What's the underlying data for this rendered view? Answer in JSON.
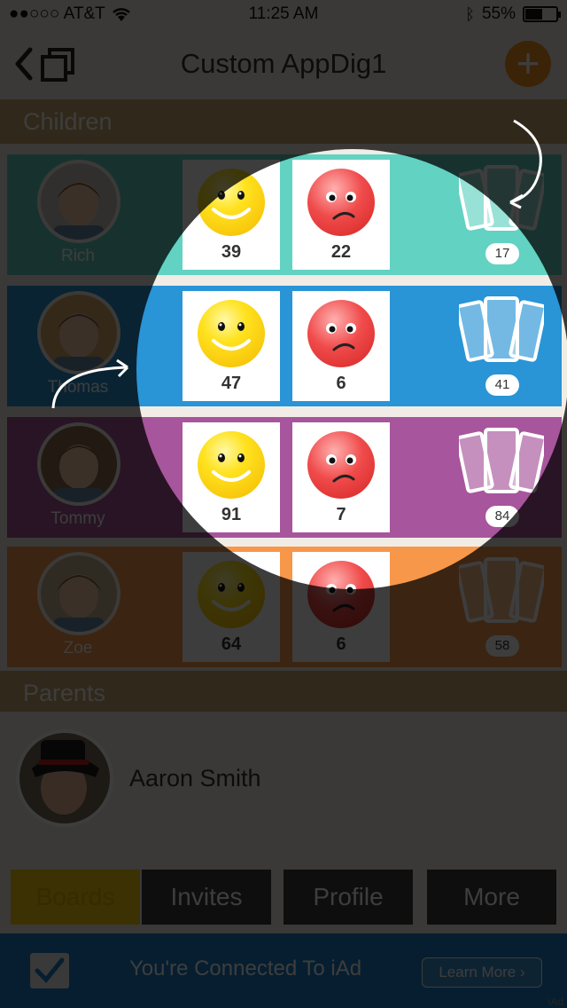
{
  "status_bar": {
    "carrier": "●●○○○ AT&T",
    "time": "11:25 AM",
    "battery_percent": "55%"
  },
  "nav": {
    "title": "Custom AppDig1",
    "back_icon": "back-chevron-icon",
    "copy_icon": "copy-icon",
    "add_icon": "plus-icon"
  },
  "children_header": "Children",
  "children": [
    {
      "name": "Rich",
      "happy": "39",
      "sad": "22",
      "cards": "17",
      "color": "#62d2c2"
    },
    {
      "name": "Thomas",
      "happy": "47",
      "sad": "6",
      "cards": "41",
      "color": "#2994d6"
    },
    {
      "name": "Tommy",
      "happy": "91",
      "sad": "7",
      "cards": "84",
      "color": "#a7559c"
    },
    {
      "name": "Zoe",
      "happy": "64",
      "sad": "6",
      "cards": "58",
      "color": "#f7974a"
    }
  ],
  "parents_header": "Parents",
  "parents": [
    {
      "name": "Aaron Smith"
    }
  ],
  "tabs": [
    {
      "label": "Boards",
      "color": "#f5cb0c",
      "text_color": "#e0b400"
    },
    {
      "label": "Invites",
      "color": "#3b3b3b",
      "text_color": "#ffffff"
    },
    {
      "label": "Profile",
      "color": "#3b3b3b",
      "text_color": "#ffffff"
    },
    {
      "label": "More",
      "color": "#3b3b3b",
      "text_color": "#ffffff"
    }
  ],
  "ad": {
    "text": "You're Connected To iAd",
    "button": "Learn More ›",
    "mark": "iAd"
  }
}
